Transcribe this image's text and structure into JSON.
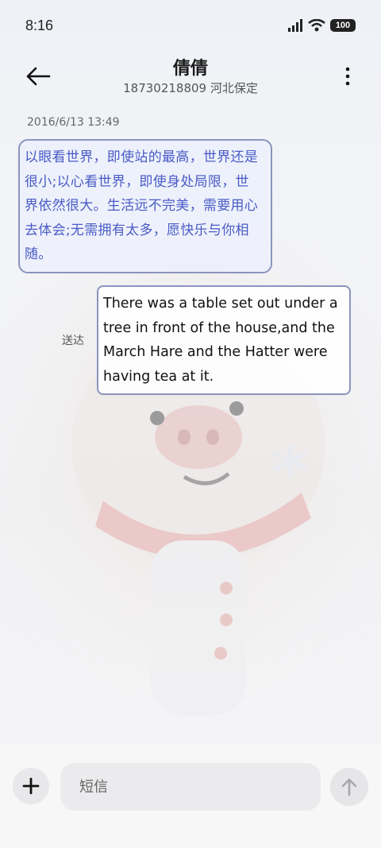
{
  "status_bar": {
    "time": "8:16",
    "battery": "100",
    "icons": [
      "signal-icon",
      "wifi-icon",
      "battery-icon"
    ]
  },
  "header": {
    "contact_name": "倩倩",
    "contact_detail": "18730218809 河北保定",
    "icons": [
      "back-arrow-icon",
      "more-vertical-icon"
    ]
  },
  "conversation": {
    "timestamp": "2016/6/13 13:49",
    "incoming_message": "以眼看世界，即使站的最高，世界还是很小;以心看世界，即使身处局限，世界依然很大。生活远不完美，需要用心去体会;无需拥有太多，愿快乐与你相随。",
    "outgoing_status": "送达",
    "outgoing_message": "There was a table set out under a tree in front of the house,and the March Hare and the Hatter were having tea at it."
  },
  "composer": {
    "placeholder": "短信",
    "value": "",
    "icons": [
      "plus-icon",
      "send-arrow-icon"
    ]
  },
  "colors": {
    "incoming_text": "#4a5bc6",
    "bubble_border": "#8b94bd"
  }
}
